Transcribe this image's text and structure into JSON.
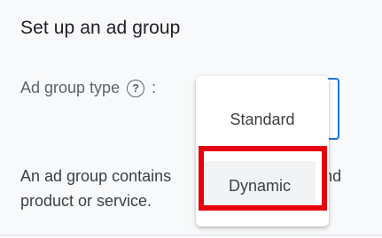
{
  "page": {
    "title": "Set up an ad group"
  },
  "ad_group_type": {
    "label": "Ad group type",
    "help_icon": "help-circle-icon",
    "separator": ":"
  },
  "dropdown": {
    "options": [
      "Standard",
      "Dynamic"
    ],
    "highlighted_option": "Dynamic"
  },
  "description": {
    "text_before": "An ad group contains",
    "text_after": "ds and",
    "line2": "product or service."
  },
  "colors": {
    "accent": "#1a73e8",
    "highlight": "#e8000b"
  }
}
